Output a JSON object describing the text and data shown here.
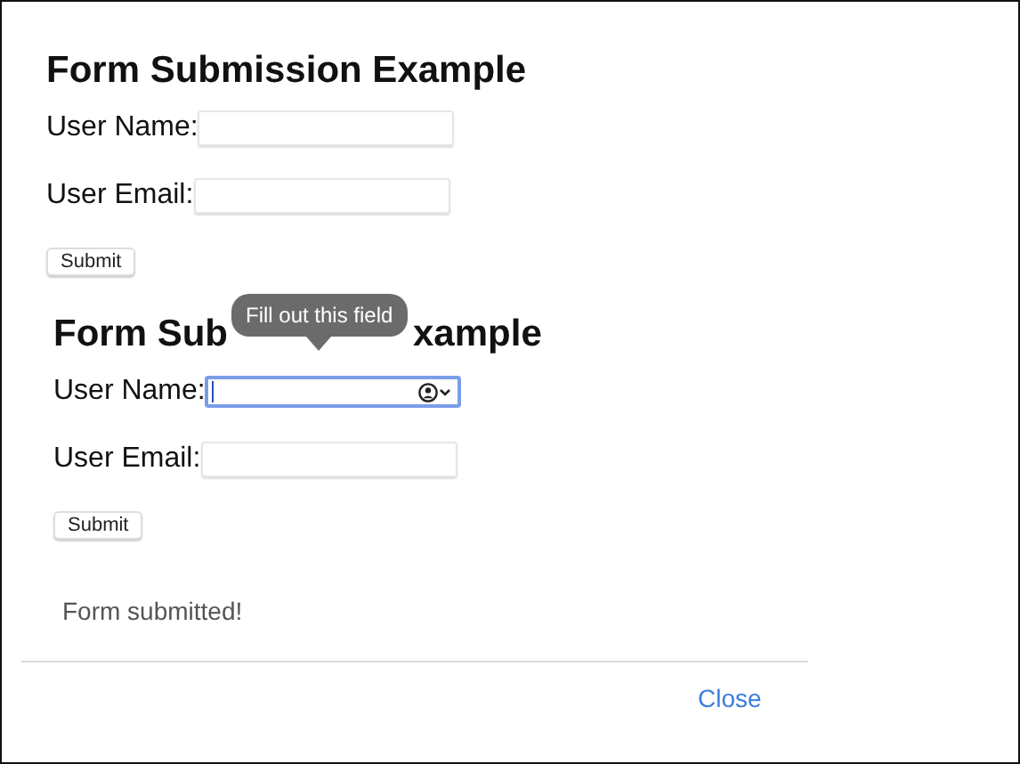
{
  "forms": [
    {
      "heading": [
        "Form Submission Example"
      ],
      "fields": [
        {
          "label": "User Name:",
          "focused": false,
          "autofill": false
        },
        {
          "label": "User Email:",
          "focused": false,
          "autofill": false
        }
      ],
      "submit": "Submit"
    },
    {
      "heading": [
        "Form Sub",
        "xample"
      ],
      "tooltip": "Fill out this field",
      "fields": [
        {
          "label": "User Name:",
          "focused": true,
          "autofill": true
        },
        {
          "label": "User Email:",
          "focused": false,
          "autofill": false
        }
      ],
      "submit": "Submit"
    }
  ],
  "message": "Form submitted!",
  "close": "Close"
}
